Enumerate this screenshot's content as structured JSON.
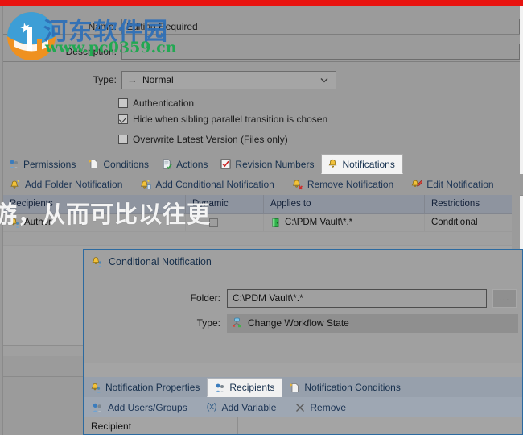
{
  "window": {
    "form": {
      "name_label": "Name:",
      "name_value": "Editing Required",
      "description_label": "Description:",
      "description_value": "",
      "type_label": "Type:",
      "type_value": "Normal",
      "checkboxes": [
        {
          "label": "Authentication",
          "checked": false
        },
        {
          "label": "Hide when sibling parallel transition is chosen",
          "checked": true
        },
        {
          "label": "Overwrite Latest Version (Files only)",
          "checked": false
        }
      ]
    },
    "tabs": [
      {
        "label": "Permissions",
        "icon": "users-icon",
        "active": false
      },
      {
        "label": "Conditions",
        "icon": "document-star-icon",
        "active": false
      },
      {
        "label": "Actions",
        "icon": "document-check-icon",
        "active": false
      },
      {
        "label": "Revision Numbers",
        "icon": "checkbox-icon",
        "active": false
      },
      {
        "label": "Notifications",
        "icon": "bell-icon",
        "active": true
      }
    ],
    "toolbar": [
      {
        "label": "Add Folder Notification",
        "icon": "bell-add-icon"
      },
      {
        "label": "Add Conditional Notification",
        "icon": "bell-conditional-icon"
      },
      {
        "label": "Remove Notification",
        "icon": "bell-remove-icon"
      },
      {
        "label": "Edit Notification",
        "icon": "bell-edit-icon"
      }
    ],
    "grid": {
      "columns": [
        "Recipients",
        "Dynamic",
        "Applies to",
        "Restrictions"
      ],
      "rows": [
        {
          "recipient": "Author",
          "recipient_icon": "bell-user-icon",
          "dynamic": false,
          "applies_to": "C:\\PDM Vault\\*.*",
          "applies_to_icon": "folder-green-icon",
          "restrictions": "Conditional"
        }
      ]
    }
  },
  "dialog": {
    "title": "Conditional Notification",
    "title_icon": "bell-user-icon",
    "folder_label": "Folder:",
    "folder_value": "C:\\PDM Vault\\*.*",
    "browse_label": "...",
    "type_label": "Type:",
    "type_value": "Change Workflow State",
    "type_icon": "workflow-state-icon",
    "tabs": [
      {
        "label": "Notification Properties",
        "icon": "bell-user-icon",
        "active": false
      },
      {
        "label": "Recipients",
        "icon": "users-icon",
        "active": true
      },
      {
        "label": "Notification Conditions",
        "icon": "document-star-icon",
        "active": false
      }
    ],
    "toolbar": [
      {
        "label": "Add Users/Groups",
        "icon": "users-icon"
      },
      {
        "label": "Add Variable",
        "icon": "variable-x-icon"
      },
      {
        "label": "Remove",
        "icon": "close-x-icon"
      }
    ],
    "grid": {
      "columns": [
        "Recipient",
        ""
      ]
    }
  },
  "watermark": {
    "site_name": "河东软件园",
    "site_url": "www.pc0359.cn",
    "overlay_text": "游，从而可比以往更",
    "colors": {
      "site_name": "#2e6fb7",
      "site_url": "#22a852",
      "top_bar": "#e8130f"
    }
  }
}
